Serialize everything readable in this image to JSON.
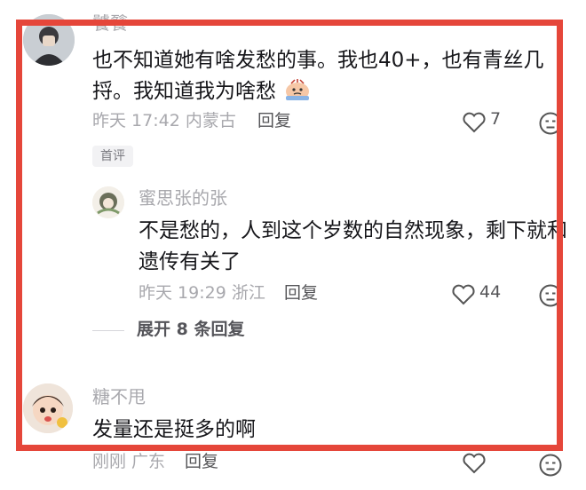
{
  "colors": {
    "highlight": "#e5463a",
    "muted": "#a8a8ad",
    "text": "#16161a",
    "tag_bg": "#f2f2f4"
  },
  "comments": [
    {
      "username": "饕餮",
      "lines": [
        "也不知道她有啥发愁的事。我也40+，也有青丝几",
        "捋。我知道我为啥愁"
      ],
      "emoji": "worried-emoji-icon",
      "meta": "昨天 17:42 内蒙古",
      "reply": "回复",
      "likes": "7",
      "tag": "首评"
    },
    {
      "username": "蜜思张的张",
      "lines": [
        "不是愁的，人到这个岁数的自然现象，剩下就和",
        "遗传有关了"
      ],
      "meta": "昨天 19:29 浙江",
      "reply": "回复",
      "likes": "44"
    },
    {
      "username": "糖不甩",
      "lines": [
        "发量还是挺多的啊"
      ],
      "meta": "刚刚 广东",
      "reply": "回复",
      "likes": ""
    }
  ],
  "expand": "展开 8 条回复",
  "icons": {
    "like": "heart-icon",
    "dislike": "dislike-face-icon"
  }
}
